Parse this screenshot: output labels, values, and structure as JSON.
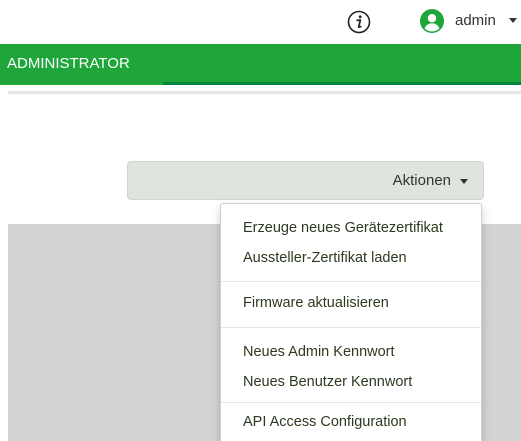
{
  "header": {
    "user_name": "admin",
    "info_icon": "info-icon",
    "user_icon": "user-circle-icon"
  },
  "nav": {
    "tabs": [
      {
        "label": "ADMINISTRATOR"
      }
    ]
  },
  "actions": {
    "label": "Aktionen"
  },
  "menu": {
    "items": [
      "Erzeuge neues Gerätezertifikat",
      "Aussteller-Zertifikat laden",
      "Firmware aktualisieren",
      "Neues Admin Kennwort",
      "Neues Benutzer Kennwort",
      "API Access Configuration"
    ]
  },
  "colors": {
    "accent": "#1fa63b",
    "accent_dark": "#00843d"
  }
}
